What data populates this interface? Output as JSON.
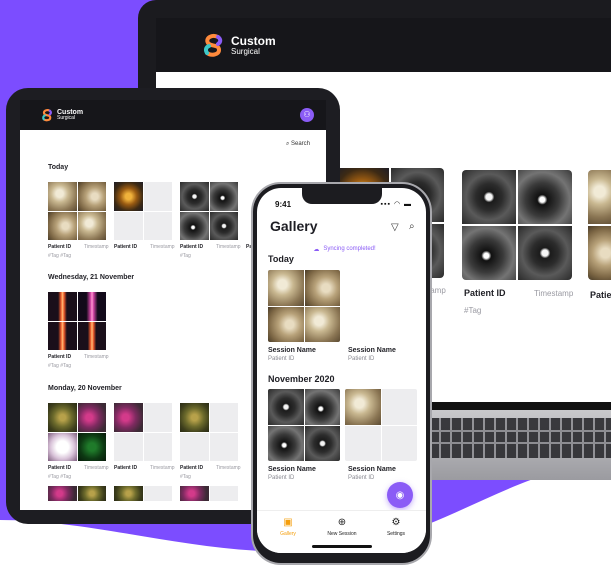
{
  "colors": {
    "accent": "#8b5cf6",
    "dark": "#16161a",
    "background_purple": "#7c4dff"
  },
  "laptop": {
    "logo": {
      "line1": "Custom",
      "line2": "Surgical"
    },
    "cards": [
      {
        "patient_id": "",
        "timestamp": "tamp",
        "tag": ""
      },
      {
        "patient_id": "Patient ID",
        "timestamp": "Timestamp",
        "tag": "#Tag"
      },
      {
        "patient_id": "Patie",
        "timestamp": "",
        "tag": ""
      }
    ]
  },
  "tablet": {
    "logo": {
      "line1": "Custom",
      "line2": "Surgical"
    },
    "avatar_icon": "user-icon",
    "search_label": "Search",
    "sections": [
      {
        "title": "Today",
        "cards": [
          {
            "patient_id": "Patient ID",
            "timestamp": "Timestamp",
            "tag": "#Tag #Tag"
          },
          {
            "patient_id": "Patient ID",
            "timestamp": "Timestamp",
            "tag": ""
          },
          {
            "patient_id": "Patient ID",
            "timestamp": "Timestamp",
            "tag": "#Tag"
          },
          {
            "patient_id": "Pa",
            "timestamp": "",
            "tag": ""
          }
        ]
      },
      {
        "title": "Wednesday, 21 November",
        "cards": [
          {
            "patient_id": "Patient ID",
            "timestamp": "Timestamp",
            "tag": "#Tag #Tag"
          }
        ]
      },
      {
        "title": "Monday, 20 November",
        "cards": [
          {
            "patient_id": "Patient ID",
            "timestamp": "Timestamp",
            "tag": "#Tag #Tag"
          },
          {
            "patient_id": "Patient ID",
            "timestamp": "Timestamp",
            "tag": ""
          },
          {
            "patient_id": "Patient ID",
            "timestamp": "Timestamp",
            "tag": "#Tag"
          }
        ]
      }
    ]
  },
  "phone": {
    "time": "9:41",
    "title": "Gallery",
    "sync_text": "Syncing completed!",
    "sections": [
      {
        "title": "Today",
        "sessions": [
          {
            "name": "Session Name",
            "patient_id": "Patient ID"
          },
          {
            "name": "Session Name",
            "patient_id": "Patient ID"
          }
        ]
      },
      {
        "title": "November 2020",
        "sessions": [
          {
            "name": "Session Name",
            "patient_id": "Patient ID"
          },
          {
            "name": "Session Name",
            "patient_id": "Patient ID"
          }
        ]
      }
    ],
    "tabs": [
      {
        "label": "Gallery",
        "icon": "gallery-icon",
        "active": true
      },
      {
        "label": "New Session",
        "icon": "plus-circle-icon",
        "active": false
      },
      {
        "label": "Settings",
        "icon": "gear-icon",
        "active": false
      }
    ]
  }
}
